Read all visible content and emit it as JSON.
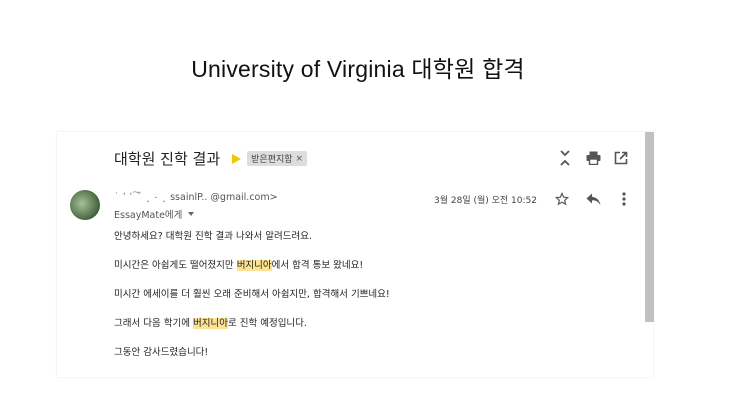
{
  "slide": {
    "title": "University of Virginia 대학원 합격"
  },
  "email": {
    "subject": "대학원 진학 결과",
    "label": "받은편지함",
    "label_close": "×",
    "sender_masked": "˙ ʼ ʿ ͠˘ ¸ ˗ ¸ ",
    "sender_partial": "ssainlP.. @gmail.com>",
    "recipient": "EssayMate에게",
    "date": "3월 28일 (월) 오전 10:52",
    "highlight_color": "#fde293",
    "body": {
      "line1": "안녕하세요? 대학원 진학 결과 나와서 알려드려요.",
      "line2_pre": "미시간은 아쉽게도 떨어졌지만 ",
      "line2_hl": "버지니아",
      "line2_post": "에서 합격 통보 왔네요!",
      "line3": "미시간 에세이를 더 훨씬 오래 준비해서 아쉽지만, 합격해서 기쁘네요!",
      "line4_pre": "그래서 다음 학기에 ",
      "line4_hl": "버지니아",
      "line4_post": "로 진학 예정입니다.",
      "line5": "그동안 감사드렸습니다!"
    }
  },
  "icons": {
    "collapse": "collapse-all-icon",
    "print": "print-icon",
    "new_window": "open-in-new-window-icon",
    "star": "star-icon",
    "reply": "reply-icon",
    "more": "more-vert-icon",
    "important": "important-marker-icon"
  }
}
